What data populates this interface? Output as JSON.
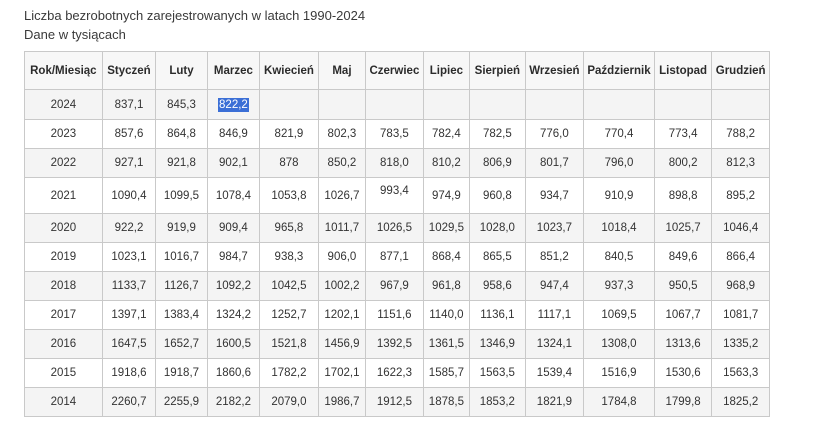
{
  "caption": {
    "title": "Liczba bezrobotnych zarejestrowanych w latach 1990-2024",
    "subtitle": "Dane w tysiącach"
  },
  "table": {
    "headers": [
      "Rok/Miesiąc",
      "Styczeń",
      "Luty",
      "Marzec",
      "Kwiecień",
      "Maj",
      "Czerwiec",
      "Lipiec",
      "Sierpień",
      "Wrzesień",
      "Październik",
      "Listopad",
      "Grudzień"
    ],
    "rows": [
      [
        "2024",
        "837,1",
        "845,3",
        "822,2",
        "",
        "",
        "",
        "",
        "",
        "",
        "",
        "",
        ""
      ],
      [
        "2023",
        "857,6",
        "864,8",
        "846,9",
        "821,9",
        "802,3",
        "783,5",
        "782,4",
        "782,5",
        "776,0",
        "770,4",
        "773,4",
        "788,2"
      ],
      [
        "2022",
        "927,1",
        "921,8",
        "902,1",
        "878",
        "850,2",
        "818,0",
        "810,2",
        "806,9",
        "801,7",
        "796,0",
        "800,2",
        "812,3"
      ],
      [
        "2021",
        "1090,4",
        "1099,5",
        "1078,4",
        "1053,8",
        "1026,7",
        "993,4",
        "974,9",
        "960,8",
        "934,7",
        "910,9",
        "898,8",
        "895,2"
      ],
      [
        "2020",
        "922,2",
        "919,9",
        "909,4",
        "965,8",
        "1011,7",
        "1026,5",
        "1029,5",
        "1028,0",
        "1023,7",
        "1018,4",
        "1025,7",
        "1046,4"
      ],
      [
        "2019",
        "1023,1",
        "1016,7",
        "984,7",
        "938,3",
        "906,0",
        "877,1",
        "868,4",
        "865,5",
        "851,2",
        "840,5",
        "849,6",
        "866,4"
      ],
      [
        "2018",
        "1133,7",
        "1126,7",
        "1092,2",
        "1042,5",
        "1002,2",
        "967,9",
        "961,8",
        "958,6",
        "947,4",
        "937,3",
        "950,5",
        "968,9"
      ],
      [
        "2017",
        "1397,1",
        "1383,4",
        "1324,2",
        "1252,7",
        "1202,1",
        "1151,6",
        "1140,0",
        "1136,1",
        "1117,1",
        "1069,5",
        "1067,7",
        "1081,7"
      ],
      [
        "2016",
        "1647,5",
        "1652,7",
        "1600,5",
        "1521,8",
        "1456,9",
        "1392,5",
        "1361,5",
        "1346,9",
        "1324,1",
        "1308,0",
        "1313,6",
        "1335,2"
      ],
      [
        "2015",
        "1918,6",
        "1918,7",
        "1860,6",
        "1782,2",
        "1702,1",
        "1622,3",
        "1585,7",
        "1563,5",
        "1539,4",
        "1516,9",
        "1530,6",
        "1563,3"
      ],
      [
        "2014",
        "2260,7",
        "2255,9",
        "2182,2",
        "2079,0",
        "1986,7",
        "1912,5",
        "1878,5",
        "1853,2",
        "1821,9",
        "1784,8",
        "1799,8",
        "1825,2"
      ]
    ]
  }
}
